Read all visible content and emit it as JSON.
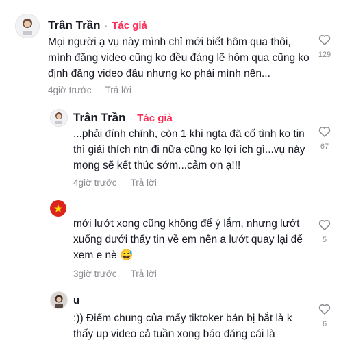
{
  "comments": [
    {
      "username": "Trân Trần",
      "author_badge": "Tác giả",
      "separator": "·",
      "text": "Mọi người ạ vụ này mình chỉ mới biết hôm qua thôi, mình đăng video cũng ko đều đáng lẽ hôm qua cũng ko định đăng video đâu nhưng ko phải mình nên...",
      "time": "4giờ trước",
      "reply_label": "Trả lời",
      "likes": "129"
    },
    {
      "username": "Trân Trần",
      "author_badge": "Tác giả",
      "separator": "·",
      "text": "...phải đính chính, còn 1 khi ngta đã cố tình ko tin thì giải thích ntn đi nữa cũng ko lợi ích gì...vụ này mong sẽ kết thúc sớm...cảm ơn ạ!!!",
      "time": "4giờ trước",
      "reply_label": "Trả lời",
      "likes": "67"
    },
    {
      "text": "mới lướt xong cũng không để ý lắm, nhưng lướt xuống dưới thấy tin về em nên a lướt quay lại để xem e nè 😅",
      "time": "3giờ trước",
      "reply_label": "Trả lời",
      "likes": "5"
    },
    {
      "username": "u",
      "text": ":)) Điểm chung của mấy tiktoker bán        bị bắt là k thấy up video cả tuần xong báo đăng cái là",
      "likes": "6"
    }
  ],
  "colors": {
    "author": "#fe2c55",
    "muted": "#8a8b91",
    "text": "#161823",
    "flag_red": "#da251d",
    "flag_star": "#ffde00"
  },
  "icons": {
    "like": "heart-outline-icon",
    "emoji": "sweat-smile-emoji"
  }
}
